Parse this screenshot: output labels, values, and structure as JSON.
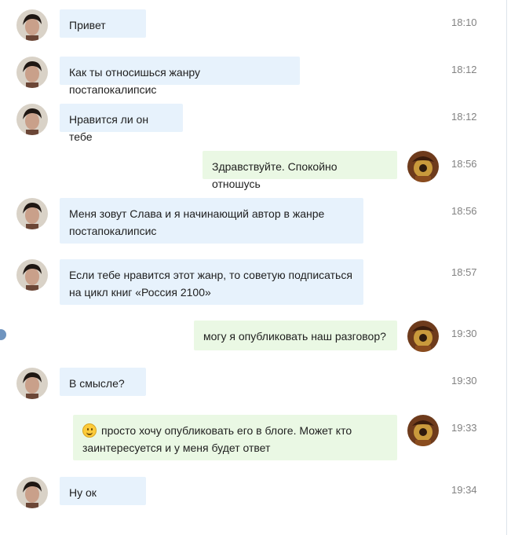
{
  "colors": {
    "incoming_bg": "#e7f2fc",
    "outgoing_bg": "#eaf8e4",
    "time": "#828282"
  },
  "messages": [
    {
      "author": "left",
      "text": "Привет",
      "time": "18:10"
    },
    {
      "author": "left",
      "text": "Как ты относишься жанру постапокалипсис",
      "time": "18:12"
    },
    {
      "author": "left",
      "text": "Нравится ли он тебе",
      "time": "18:12"
    },
    {
      "author": "right",
      "text": "Здравствуйте. Спокойно отношусь",
      "time": "18:56"
    },
    {
      "author": "left",
      "text": "Меня зовут Слава и я начинающий автор в жанре постапокалипсис",
      "time": "18:56"
    },
    {
      "author": "left",
      "text": "Если тебе нравится этот жанр, то советую подписаться на цикл книг «Россия 2100»",
      "time": "18:57"
    },
    {
      "author": "right",
      "text": "могу я опубликовать наш разговор?",
      "time": "19:30"
    },
    {
      "author": "left",
      "text": "В смысле?",
      "time": "19:30"
    },
    {
      "author": "right",
      "text": "просто хочу опубликовать его в блоге. Может кто заинтересуется и у меня будет ответ",
      "time": "19:33",
      "emoji": "smile-emoji"
    },
    {
      "author": "left",
      "text": "Ну ок",
      "time": "19:34"
    }
  ]
}
